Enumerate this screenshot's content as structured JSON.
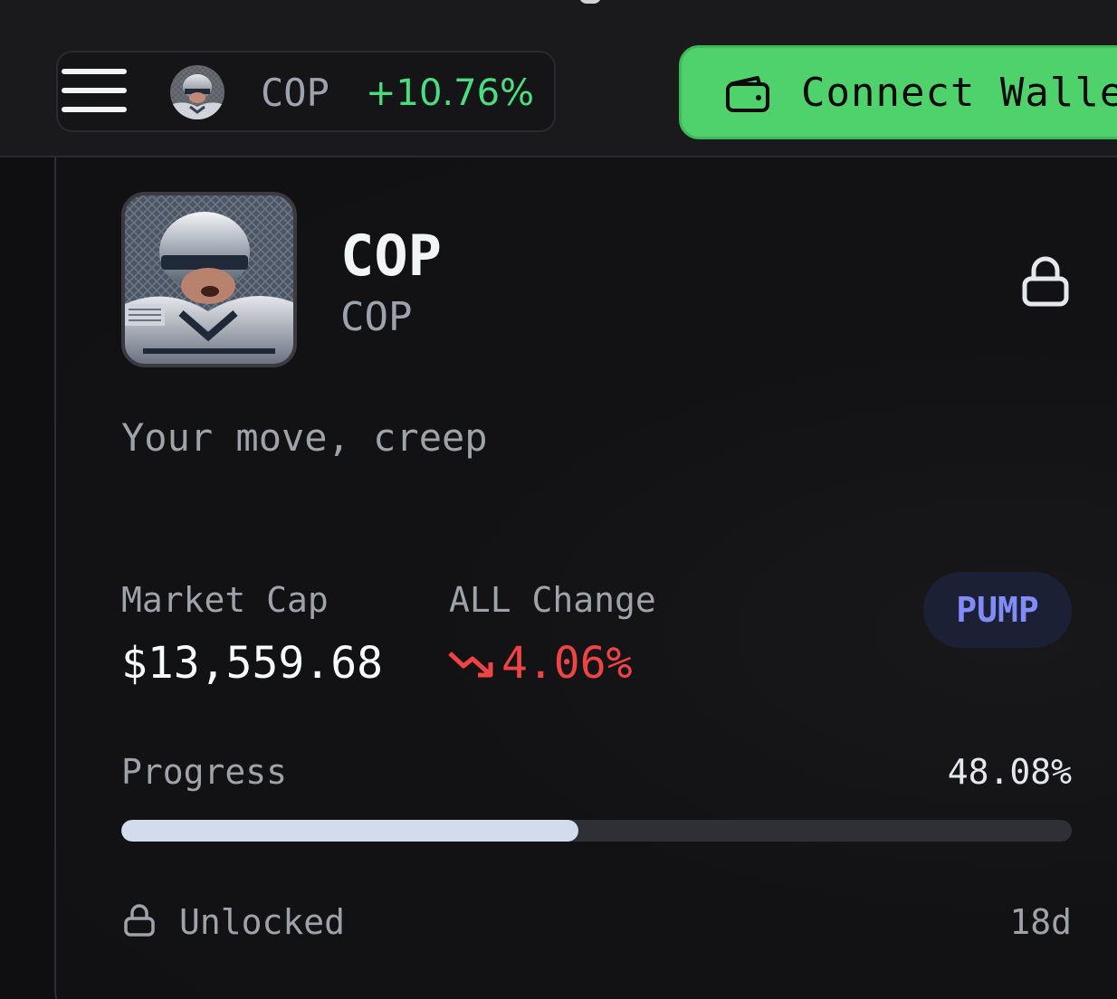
{
  "header": {
    "token_symbol": "COP",
    "token_change": "+10.76%",
    "connect_label": "Connect Wallet"
  },
  "token": {
    "name": "COP",
    "symbol": "COP",
    "description": "Your move, creep"
  },
  "stats": {
    "market_cap_label": "Market Cap",
    "market_cap_value": "$13,559.68",
    "change_label": "ALL Change",
    "change_value": "4.06%",
    "badge": "PUMP"
  },
  "progress": {
    "label": "Progress",
    "percent_text": "48.08%",
    "value": 48.08
  },
  "unlock": {
    "label": "Unlocked",
    "time": "18d"
  },
  "colors": {
    "accent_green": "#4fd16b",
    "positive": "#4ade80",
    "negative": "#ef4444",
    "badge_text": "#818cf8"
  },
  "icons": {
    "menu": "hamburger-icon",
    "wallet": "wallet-icon",
    "lock": "lock-icon",
    "trend": "trend-down-icon"
  }
}
